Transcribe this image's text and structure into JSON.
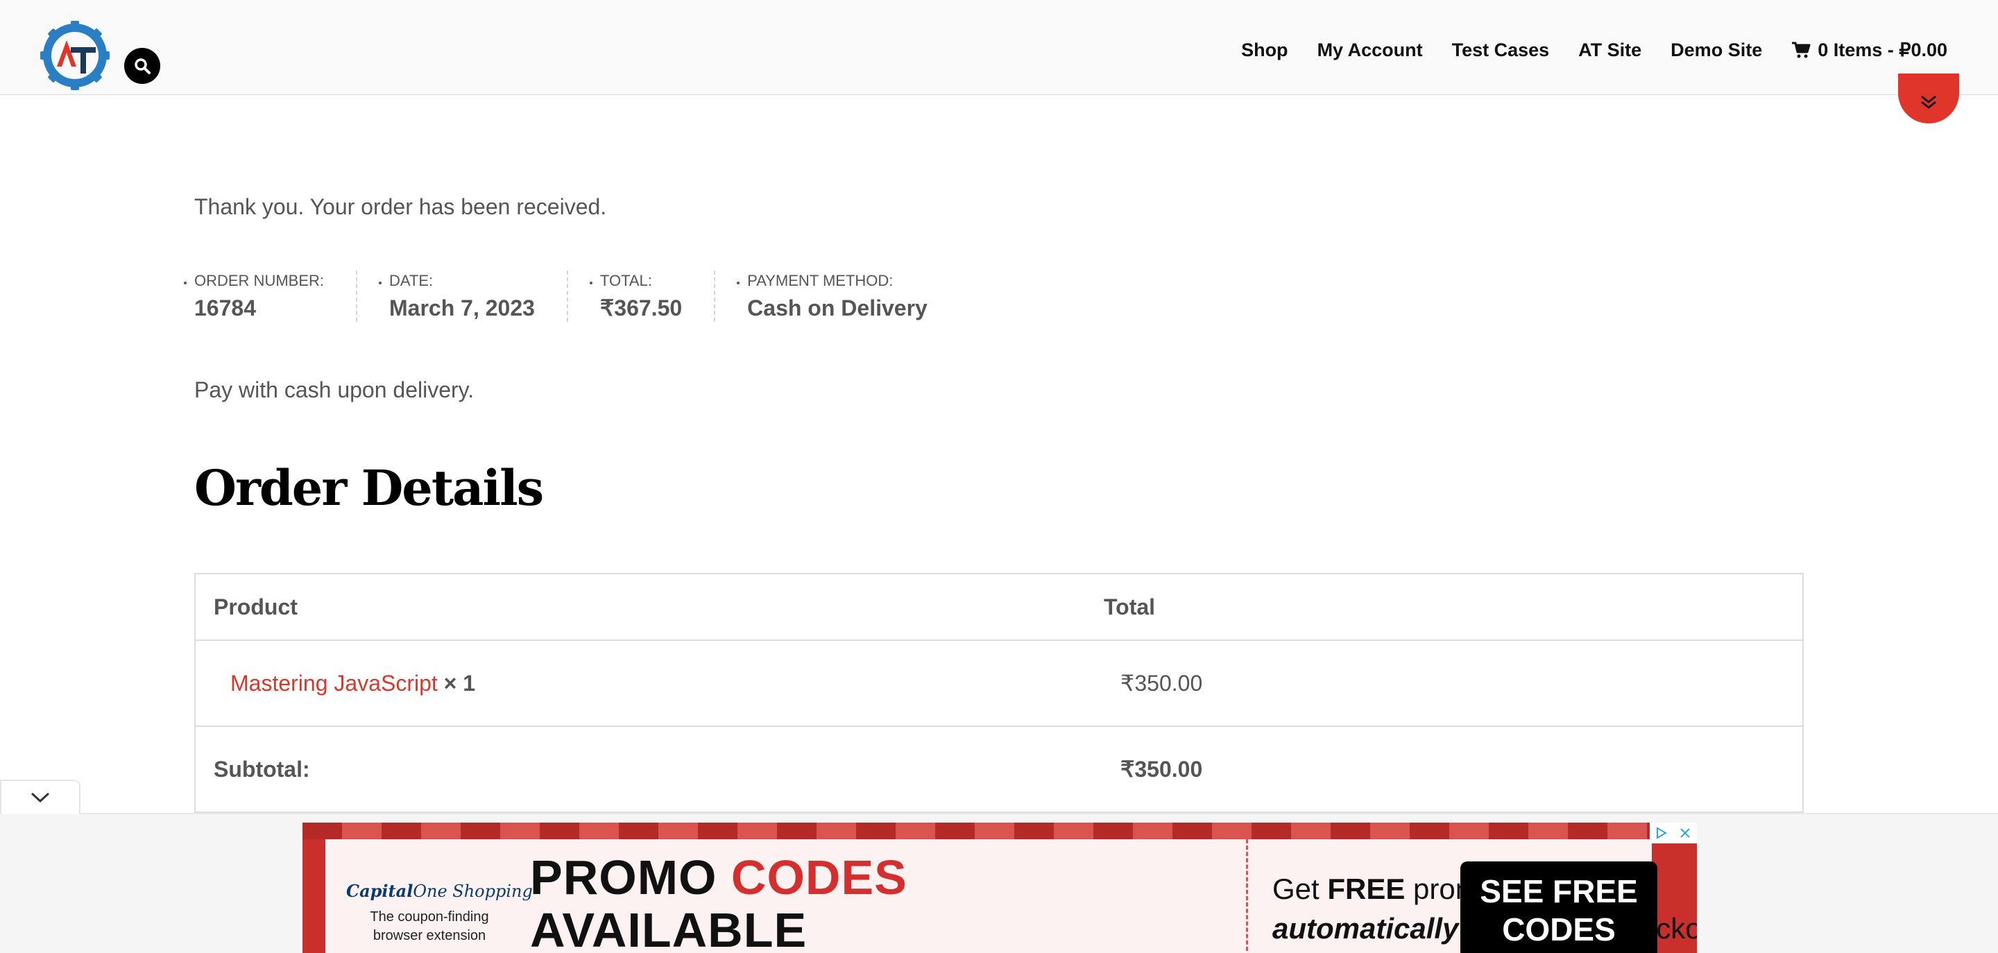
{
  "header": {
    "logo_letters": "AT",
    "nav": [
      {
        "label": "Shop"
      },
      {
        "label": "My Account"
      },
      {
        "label": "Test Cases"
      },
      {
        "label": "AT Site"
      },
      {
        "label": "Demo Site"
      }
    ],
    "cart_label": "0 Items - ₽0.00",
    "icons": {
      "search": "search-icon",
      "cart": "cart-icon",
      "toggle": "chevron-double-down-icon"
    },
    "toggle_color": "#e0352b"
  },
  "order": {
    "notice": "Thank you. Your order has been received.",
    "overview": [
      {
        "label": "Order number:",
        "value": "16784"
      },
      {
        "label": "Date:",
        "value": "March 7, 2023"
      },
      {
        "label": "Total:",
        "value": "₹367.50"
      },
      {
        "label": "Payment method:",
        "value": "Cash on Delivery"
      }
    ],
    "payment_note": "Pay with cash upon delivery.",
    "details_title": "Order Details",
    "table": {
      "headers": {
        "product": "Product",
        "total": "Total"
      },
      "items": [
        {
          "name": "Mastering JavaScript",
          "qty": "× 1",
          "total": "₹350.00"
        }
      ],
      "footer": [
        {
          "label": "Subtotal:",
          "value": "₹350.00"
        }
      ]
    },
    "link_color": "#d33a2c"
  },
  "ad": {
    "logo_brand": "Capital",
    "logo_brand_rest": "One Shopping",
    "logo_tagline_1": "The coupon-finding",
    "logo_tagline_2": "browser extension",
    "headline_part1": "PROMO ",
    "headline_part2": "CODES",
    "headline_line2": "AVAILABLE",
    "copy_1_pre": "Get ",
    "copy_1_bold": "FREE",
    "copy_1_post": " promo codes",
    "copy_2_italic": "automatically applied",
    "copy_2_post": " at checkout.",
    "cta_line1": "SEE FREE",
    "cta_line2": "CODES",
    "icons": {
      "collapse": "chevron-down-icon",
      "adchoices": "adchoices-icon",
      "close": "close-icon"
    },
    "brand_color": "#c9302c"
  }
}
